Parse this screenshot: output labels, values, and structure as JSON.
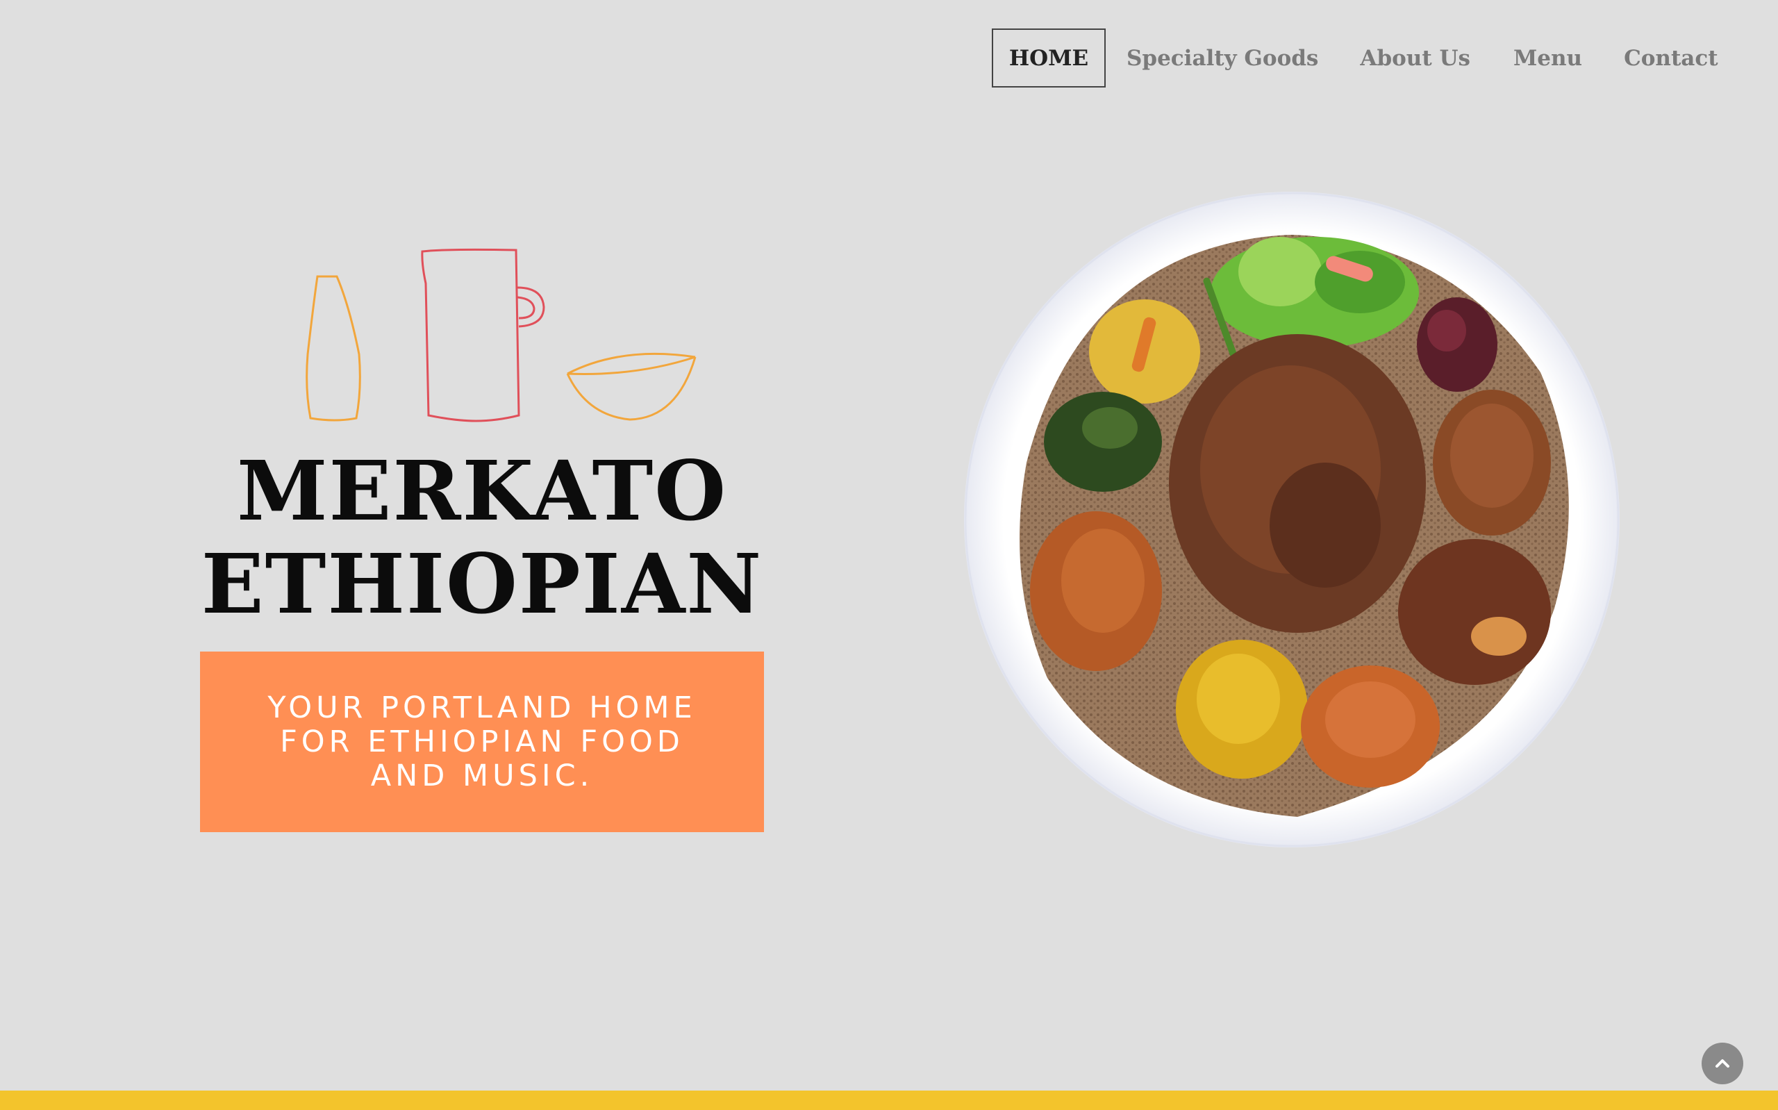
{
  "nav": {
    "items": [
      {
        "label": "HOME",
        "active": true
      },
      {
        "label": "Specialty Goods",
        "active": false
      },
      {
        "label": "About Us",
        "active": false
      },
      {
        "label": "Menu",
        "active": false
      },
      {
        "label": "Contact",
        "active": false
      }
    ]
  },
  "hero": {
    "title_line1": "MERKATO",
    "title_line2": "ETHIOPIAN",
    "tagline": "YOUR PORTLAND HOME FOR ETHIOPIAN FOOD AND MUSIC."
  },
  "icons": {
    "logo_icons": [
      "bottle-icon",
      "jug-icon",
      "bowl-icon"
    ],
    "scroll_top": "chevron-up-icon"
  },
  "colors": {
    "background": "#dfdfdf",
    "accent_orange": "#ff8f54",
    "footer_yellow": "#f3c42c",
    "bottle_stroke": "#f2a63c",
    "jug_stroke": "#e0505a",
    "bowl_stroke": "#f2a63c",
    "nav_text": "#7a7a7a",
    "nav_active": "#222222"
  }
}
